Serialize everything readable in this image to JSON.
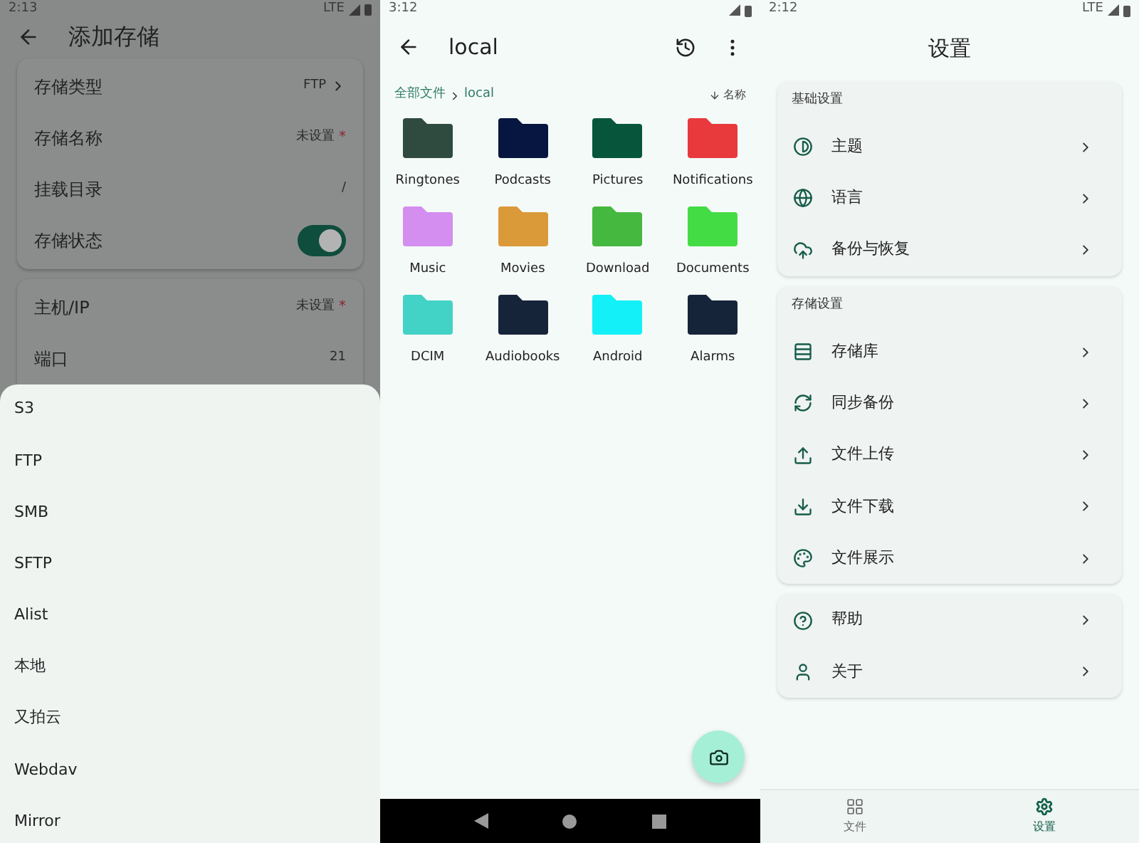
{
  "storage_screen": {
    "status_bar": {
      "time": "2:13",
      "network": "LTE"
    },
    "title": "添加存储",
    "cards": [
      {
        "rows": [
          {
            "label": "存储类型",
            "kind": "link",
            "value": "FTP"
          },
          {
            "label": "存储名称",
            "kind": "value",
            "value": "未设置",
            "marker": "*"
          },
          {
            "label": "挂载目录",
            "kind": "value",
            "value": "/"
          },
          {
            "label": "存储状态",
            "kind": "switch",
            "on": true
          }
        ]
      },
      {
        "rows": [
          {
            "label": "主机/IP",
            "kind": "value",
            "value": "未设置",
            "marker": "*"
          },
          {
            "label": "端口",
            "kind": "value",
            "value": "21"
          }
        ]
      }
    ],
    "sheet": {
      "options": [
        "S3",
        "FTP",
        "SMB",
        "SFTP",
        "Alist",
        "本地",
        "又拍云",
        "Webdav",
        "Mirror"
      ]
    }
  },
  "files_screen": {
    "status_bar": {
      "time": "3:12"
    },
    "title": "local",
    "breadcrumb": [
      "全部文件",
      "local"
    ],
    "sort": "名称",
    "folders": [
      {
        "name": "Ringtones",
        "color": "#2f4a3e"
      },
      {
        "name": "Podcasts",
        "color": "#061640"
      },
      {
        "name": "Pictures",
        "color": "#07563c"
      },
      {
        "name": "Notifications",
        "color": "#e8393c"
      },
      {
        "name": "Music",
        "color": "#d48ef0"
      },
      {
        "name": "Movies",
        "color": "#db9a3a"
      },
      {
        "name": "Download",
        "color": "#45b83f"
      },
      {
        "name": "Documents",
        "color": "#44dc45"
      },
      {
        "name": "DCIM",
        "color": "#43d2c6"
      },
      {
        "name": "Audiobooks",
        "color": "#16243a"
      },
      {
        "name": "Android",
        "color": "#13f0f7"
      },
      {
        "name": "Alarms",
        "color": "#16243a"
      }
    ]
  },
  "settings_screen": {
    "status_bar": {
      "time": "2:12",
      "network": "LTE"
    },
    "title": "设置",
    "groups": [
      {
        "title": "基础设置",
        "items": [
          "主题",
          "语言",
          "备份与恢复"
        ]
      },
      {
        "title": "存储设置",
        "items": [
          "存储库",
          "同步备份",
          "文件上传",
          "文件下载",
          "文件展示"
        ]
      },
      {
        "items": [
          "帮助",
          "关于"
        ]
      }
    ],
    "bottom_nav": [
      {
        "label": "文件",
        "selected": false
      },
      {
        "label": "设置",
        "selected": true
      }
    ]
  }
}
